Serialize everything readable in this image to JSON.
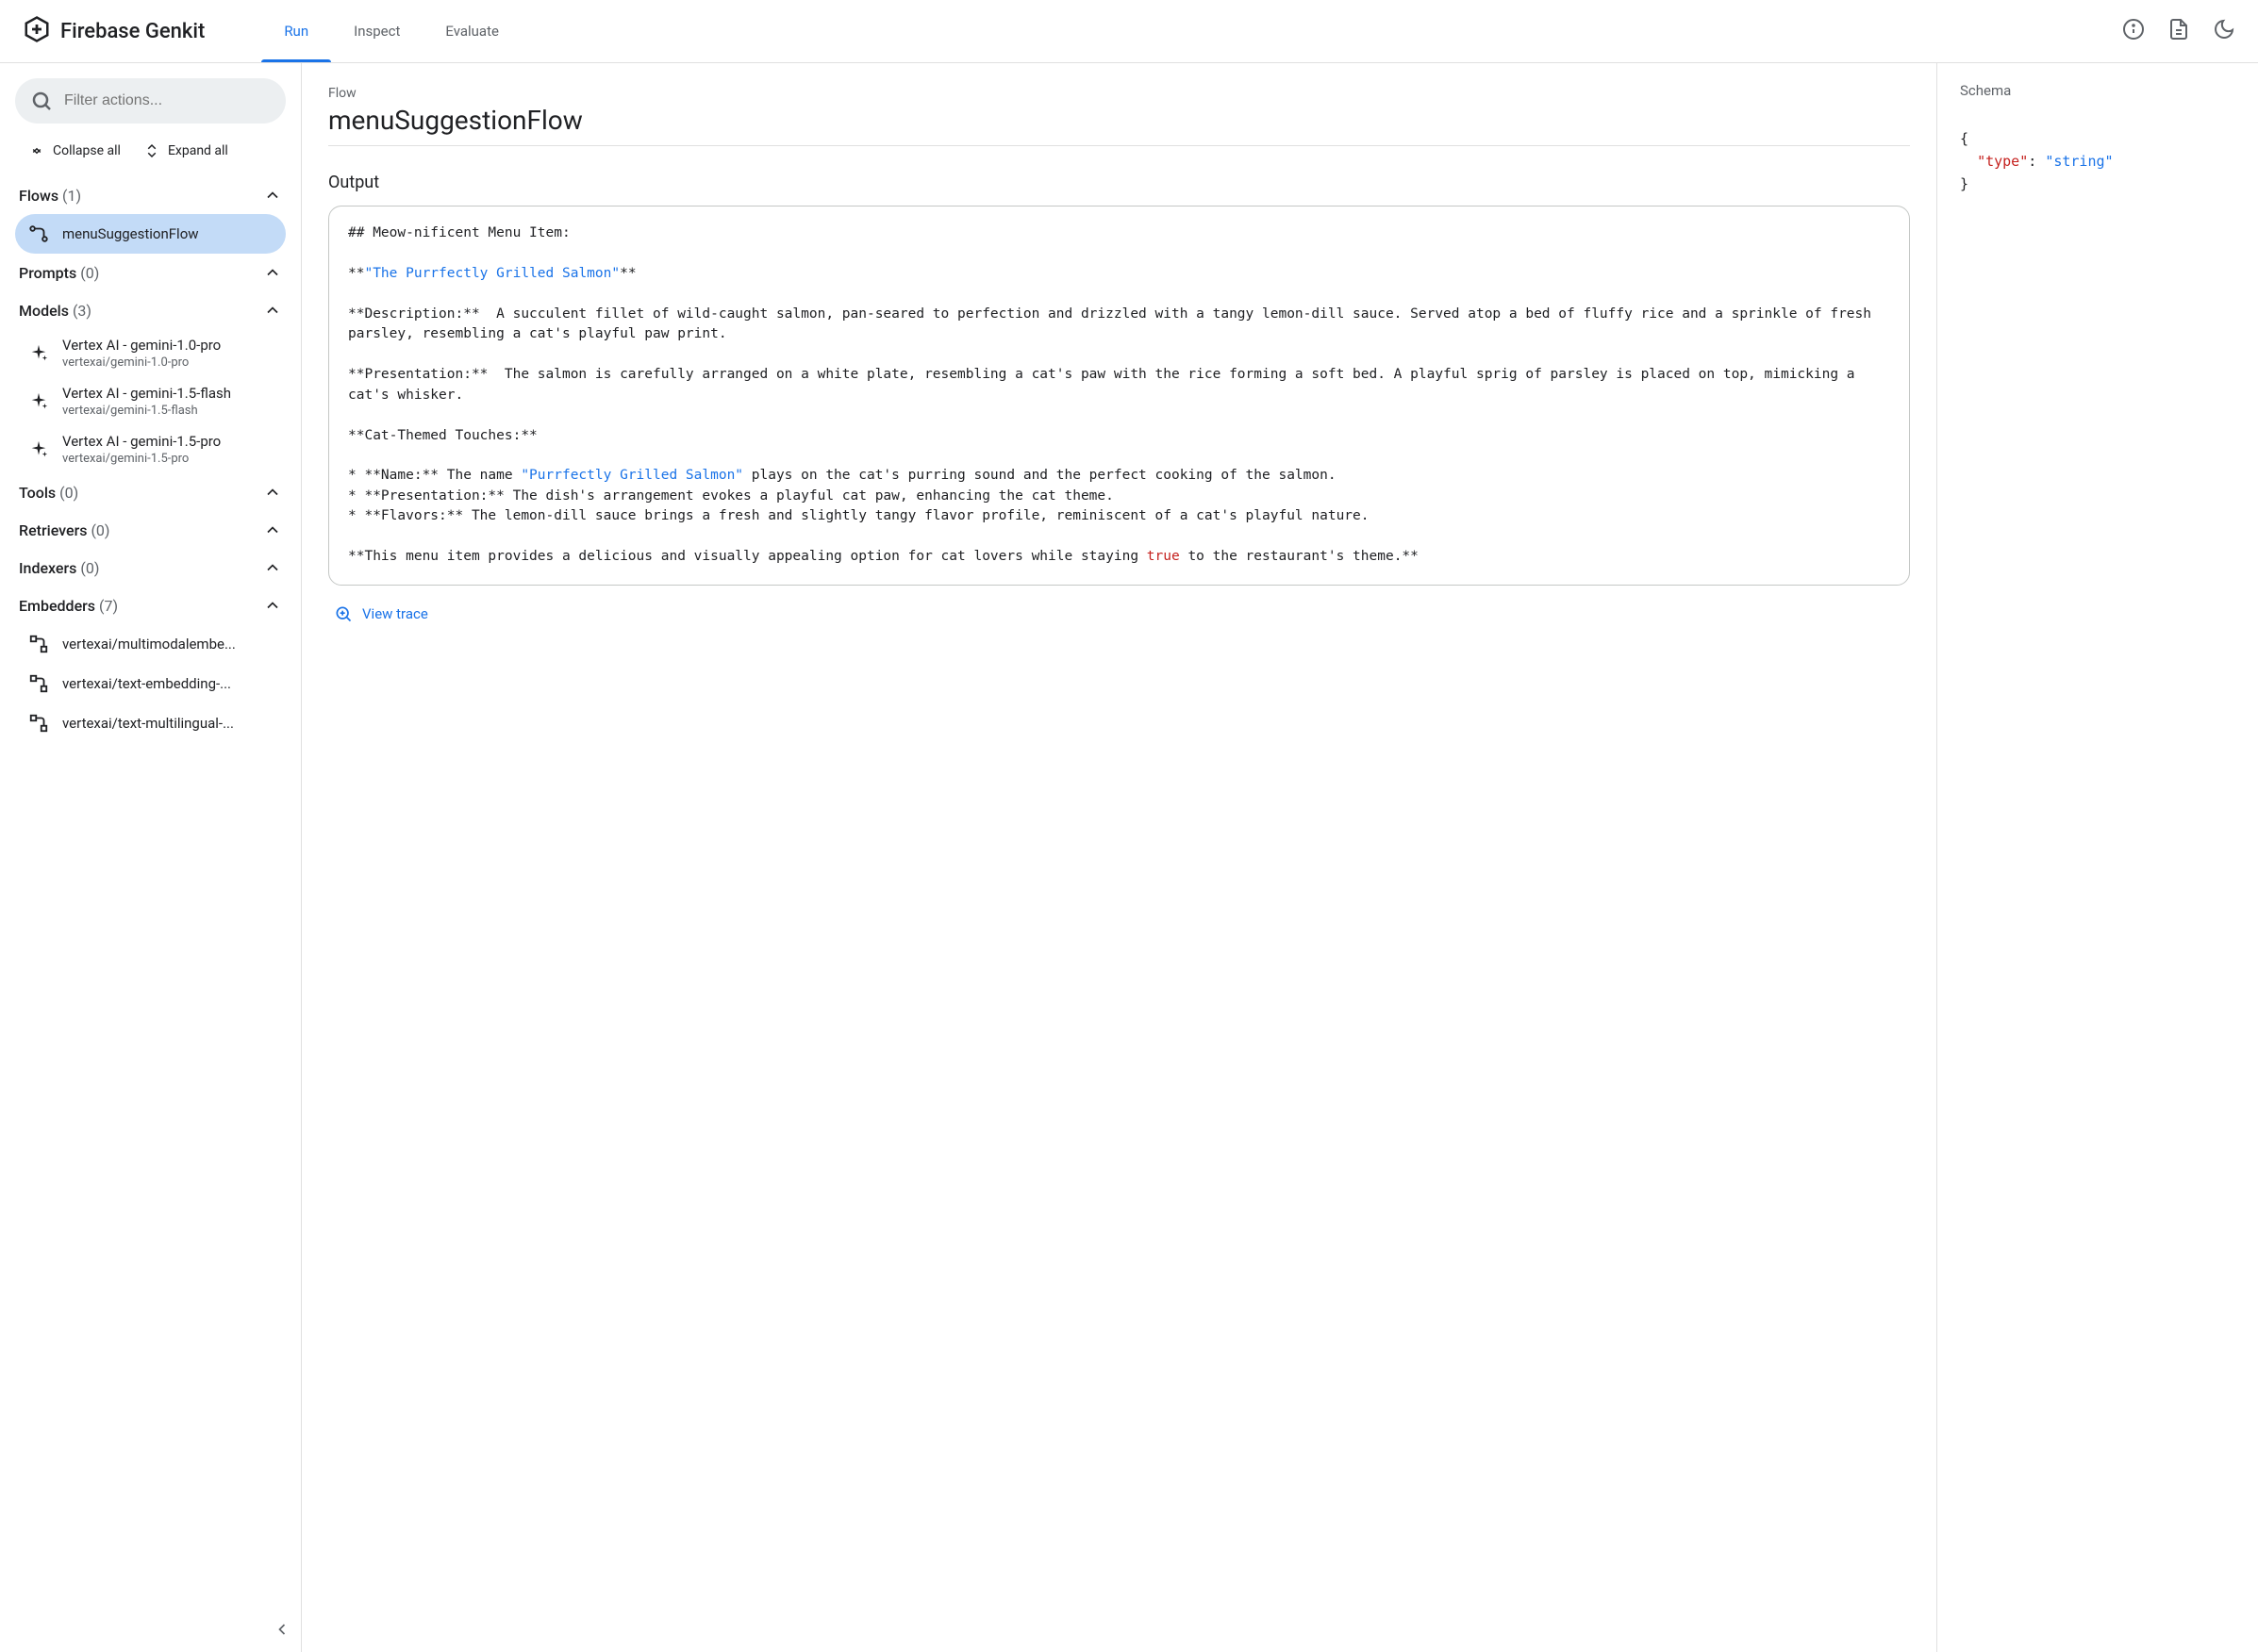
{
  "header": {
    "logo_text": "Firebase Genkit",
    "tabs": [
      "Run",
      "Inspect",
      "Evaluate"
    ],
    "active_tab": 0
  },
  "sidebar": {
    "filter_placeholder": "Filter actions...",
    "collapse_label": "Collapse all",
    "expand_label": "Expand all",
    "sections": {
      "flows": {
        "label": "Flows",
        "count": "(1)",
        "items": [
          "menuSuggestionFlow"
        ],
        "active": 0
      },
      "prompts": {
        "label": "Prompts",
        "count": "(0)"
      },
      "models": {
        "label": "Models",
        "count": "(3)",
        "items": [
          {
            "name": "Vertex AI - gemini-1.0-pro",
            "sub": "vertexai/gemini-1.0-pro"
          },
          {
            "name": "Vertex AI - gemini-1.5-flash",
            "sub": "vertexai/gemini-1.5-flash"
          },
          {
            "name": "Vertex AI - gemini-1.5-pro",
            "sub": "vertexai/gemini-1.5-pro"
          }
        ]
      },
      "tools": {
        "label": "Tools",
        "count": "(0)"
      },
      "retrievers": {
        "label": "Retrievers",
        "count": "(0)"
      },
      "indexers": {
        "label": "Indexers",
        "count": "(0)"
      },
      "embedders": {
        "label": "Embedders",
        "count": "(7)",
        "items": [
          "vertexai/multimodalembe...",
          "vertexai/text-embedding-...",
          "vertexai/text-multilingual-..."
        ]
      }
    }
  },
  "main": {
    "breadcrumb": "Flow",
    "title": "menuSuggestionFlow",
    "output_label": "Output",
    "output_segments": [
      {
        "t": "## Meow-nificent Menu Item:\n\n**"
      },
      {
        "t": "\"The Purrfectly Grilled Salmon\"",
        "c": "json-str"
      },
      {
        "t": "**\n\n**Description:**  A succulent fillet of wild-caught salmon, pan-seared to perfection and drizzled with a tangy lemon-dill sauce. Served atop a bed of fluffy rice and a sprinkle of fresh parsley, resembling a cat's playful paw print.\n\n**Presentation:**  The salmon is carefully arranged on a white plate, resembling a cat's paw with the rice forming a soft bed. A playful sprig of parsley is placed on top, mimicking a cat's whisker.\n\n**Cat-Themed Touches:**\n\n* **Name:** The name "
      },
      {
        "t": "\"Purrfectly Grilled Salmon\"",
        "c": "json-str"
      },
      {
        "t": " plays on the cat's purring sound and the perfect cooking of the salmon.\n* **Presentation:** The dish's arrangement evokes a playful cat paw, enhancing the cat theme.\n* **Flavors:** The lemon-dill sauce brings a fresh and slightly tangy flavor profile, reminiscent of a cat's playful nature.\n\n**This menu item provides a delicious and visually appealing option for cat lovers while staying "
      },
      {
        "t": "true",
        "c": "json-kw"
      },
      {
        "t": " to the restaurant's theme.**"
      }
    ],
    "view_trace_label": "View trace"
  },
  "schema": {
    "label": "Schema",
    "body_segments": [
      {
        "t": "{\n  "
      },
      {
        "t": "\"type\"",
        "c": "json-key"
      },
      {
        "t": ": "
      },
      {
        "t": "\"string\"",
        "c": "json-val"
      },
      {
        "t": "\n}"
      }
    ]
  }
}
